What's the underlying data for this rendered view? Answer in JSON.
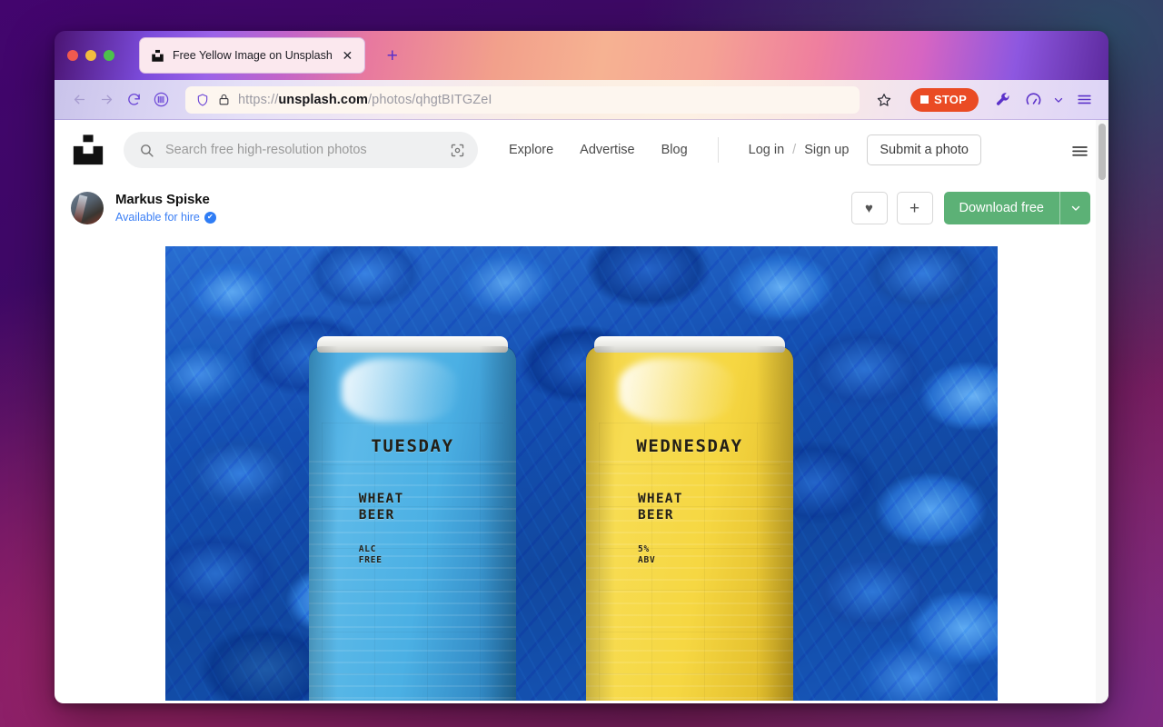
{
  "browser": {
    "tab": {
      "title": "Free Yellow Image on Unsplash",
      "favicon": "unsplash-favicon-icon",
      "close_label": "✕"
    },
    "new_tab_label": "+",
    "nav": {
      "back_icon": "back-arrow-icon",
      "forward_icon": "forward-arrow-icon",
      "reload_icon": "reload-icon",
      "library_icon": "library-icon",
      "shield_icon": "shield-icon",
      "lock_icon": "padlock-icon",
      "url_scheme": "https://",
      "url_host": "unsplash.com",
      "url_path": "/photos/qhgtBITGZeI",
      "url_full": "https://unsplash.com/photos/qhgtBITGZeI",
      "bookmark_icon": "star-icon"
    },
    "stop_button": {
      "label": "STOP",
      "color": "#ea4b24"
    },
    "tools": {
      "wrench_icon": "wrench-icon",
      "gauge_icon": "gauge-icon",
      "chevron_icon": "chevron-down-icon",
      "menu_icon": "hamburger-menu-icon"
    }
  },
  "site": {
    "logo": "unsplash-logo",
    "search": {
      "placeholder": "Search free high-resolution photos",
      "value": "",
      "search_icon": "search-icon",
      "visual_search_icon": "visual-search-icon"
    },
    "nav_links": [
      {
        "label": "Explore"
      },
      {
        "label": "Advertise"
      },
      {
        "label": "Blog"
      }
    ],
    "auth": {
      "login": "Log in",
      "separator": "/",
      "signup": "Sign up",
      "submit": "Submit a photo"
    },
    "menu_icon": "hamburger-menu-icon"
  },
  "photo_header": {
    "author_name": "Markus Spiske",
    "available_for_hire": "Available for hire",
    "verified_mark": "✔",
    "avatar": "author-avatar",
    "like_icon": "♥",
    "add_icon": "+",
    "download_label": "Download free",
    "download_caret": "chevron-down-icon",
    "download_color": "#5cb176"
  },
  "photo": {
    "alt": "Two beverage cans on a bed of blue hydrangea petals",
    "cans": [
      {
        "id": "blue-can",
        "day": "TUESDAY",
        "type_line1": "WHEAT",
        "type_line2": "BEER",
        "abv_line1": "ALC",
        "abv_line2": "FREE",
        "color": "#4bb0e4"
      },
      {
        "id": "yellow-can",
        "day": "WEDNESDAY",
        "type_line1": "WHEAT",
        "type_line2": "BEER",
        "abv_line1": "5%",
        "abv_line2": "ABV",
        "color": "#f6d742"
      }
    ],
    "background": "#1a4ea6"
  }
}
